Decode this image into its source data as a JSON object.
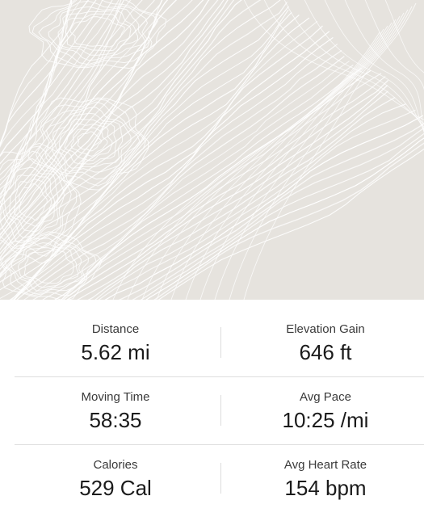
{
  "map": {
    "background_color": "#e6e3de",
    "contour_color": "#ffffff"
  },
  "stats": [
    {
      "left": {
        "label": "Distance",
        "value": "5.62 mi"
      },
      "right": {
        "label": "Elevation Gain",
        "value": "646 ft"
      }
    },
    {
      "left": {
        "label": "Moving Time",
        "value": "58:35"
      },
      "right": {
        "label": "Avg Pace",
        "value": "10:25 /mi"
      }
    },
    {
      "left": {
        "label": "Calories",
        "value": "529 Cal"
      },
      "right": {
        "label": "Avg Heart Rate",
        "value": "154 bpm"
      }
    }
  ]
}
